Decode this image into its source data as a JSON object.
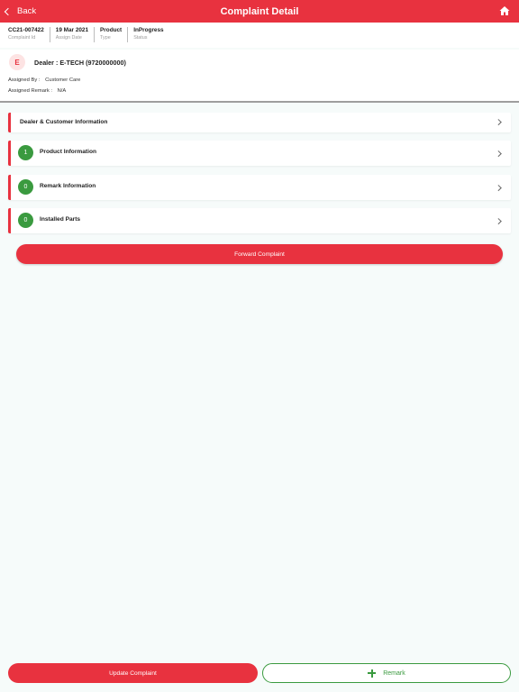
{
  "header": {
    "back_label": "Back",
    "title": "Complaint Detail",
    "home_icon": "home-icon"
  },
  "summary": [
    {
      "value": "CC21-007422",
      "label": "Complaint Id"
    },
    {
      "value": "19 Mar 2021",
      "label": "Assign Date"
    },
    {
      "value": "Product",
      "label": "Type"
    },
    {
      "value": "InProgress",
      "label": "Status"
    }
  ],
  "dealer": {
    "initial": "E",
    "name": "Dealer : E-TECH (9720000000)",
    "assigned_by_label": "Assigned By :",
    "assigned_by_value": "Customer Care",
    "assigned_remark_label": "Assigned Remark :",
    "assigned_remark_value": "N/A"
  },
  "sections": [
    {
      "label": "Dealer & Customer Information"
    },
    {
      "label": "Product Information",
      "count": "1"
    },
    {
      "label": "Remark Information",
      "count": "0"
    },
    {
      "label": "Installed Parts",
      "count": "0"
    }
  ],
  "actions": {
    "forward_label": "Forward Complaint",
    "update_label": "Update Complaint",
    "remark_label": "Remark"
  },
  "colors": {
    "brand_red": "#e8323f",
    "success_green": "#3a9a3f"
  }
}
